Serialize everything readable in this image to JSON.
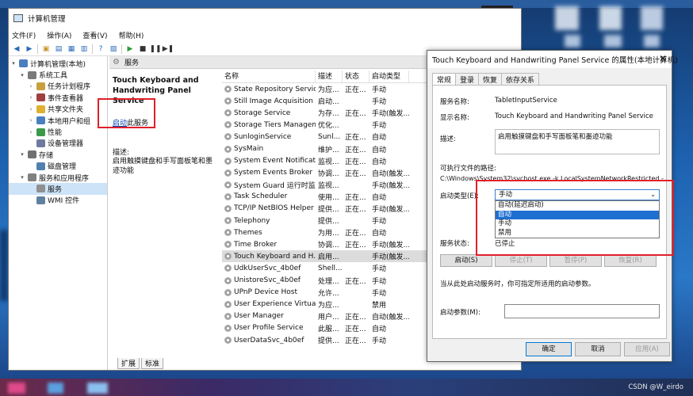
{
  "window": {
    "title": "计算机管理",
    "minimize_glyph": "—"
  },
  "menu": [
    "文件(F)",
    "操作(A)",
    "查看(V)",
    "帮助(H)"
  ],
  "tree": [
    {
      "label": "计算机管理(本地)",
      "level": 0,
      "arrow": "▾",
      "color": "#4a7fc0"
    },
    {
      "label": "系统工具",
      "level": 1,
      "arrow": "▾",
      "color": "#7a7a7a"
    },
    {
      "label": "任务计划程序",
      "level": 2,
      "arrow": "›",
      "color": "#c8a040"
    },
    {
      "label": "事件查看器",
      "level": 2,
      "arrow": "›",
      "color": "#a04040"
    },
    {
      "label": "共享文件夹",
      "level": 2,
      "arrow": "›",
      "color": "#e0b030"
    },
    {
      "label": "本地用户和组",
      "level": 2,
      "arrow": "›",
      "color": "#4a80c0"
    },
    {
      "label": "性能",
      "level": 2,
      "arrow": "›",
      "color": "#3a9a4a"
    },
    {
      "label": "设备管理器",
      "level": 2,
      "arrow": "",
      "color": "#707aa0"
    },
    {
      "label": "存储",
      "level": 1,
      "arrow": "▾",
      "color": "#707070"
    },
    {
      "label": "磁盘管理",
      "level": 2,
      "arrow": "",
      "color": "#5080b0"
    },
    {
      "label": "服务和应用程序",
      "level": 1,
      "arrow": "▾",
      "color": "#808080"
    },
    {
      "label": "服务",
      "level": 2,
      "arrow": "",
      "color": "#909090",
      "selected": true
    },
    {
      "label": "WMI 控件",
      "level": 2,
      "arrow": "",
      "color": "#6080a0"
    }
  ],
  "services_header": "服务",
  "detail": {
    "name_line1": "Touch Keyboard and",
    "name_line2": "Handwriting Panel Service",
    "start_link": "启动",
    "start_suffix": "此服务",
    "desc_label": "描述:",
    "desc_text": "启用触摸键盘和手写面板笔和墨迹功能"
  },
  "columns": [
    "名称",
    "描述",
    "状态",
    "启动类型"
  ],
  "rows": [
    [
      "State Repository Service",
      "为应...",
      "正在...",
      "手动"
    ],
    [
      "Still Image Acquisition E...",
      "启动...",
      "",
      "手动"
    ],
    [
      "Storage Service",
      "为存...",
      "正在...",
      "手动(触发..."
    ],
    [
      "Storage Tiers Managem...",
      "优化...",
      "",
      "手动"
    ],
    [
      "SunloginService",
      "Sunl...",
      "正在...",
      "自动"
    ],
    [
      "SysMain",
      "维护...",
      "正在...",
      "自动"
    ],
    [
      "System Event Notificati...",
      "监视...",
      "正在...",
      "自动"
    ],
    [
      "System Events Broker",
      "协调...",
      "正在...",
      "自动(触发..."
    ],
    [
      "System Guard 运行时监...",
      "监视...",
      "",
      "手动(触发..."
    ],
    [
      "Task Scheduler",
      "使用...",
      "正在...",
      "自动"
    ],
    [
      "TCP/IP NetBIOS Helper",
      "提供...",
      "正在...",
      "手动(触发..."
    ],
    [
      "Telephony",
      "提供...",
      "",
      "手动"
    ],
    [
      "Themes",
      "为用...",
      "正在...",
      "自动"
    ],
    [
      "Time Broker",
      "协调...",
      "正在...",
      "手动(触发..."
    ],
    [
      "Touch Keyboard and H...",
      "启用...",
      "",
      "手动(触发...",
      true
    ],
    [
      "UdkUserSvc_4b0ef",
      "Shell...",
      "",
      "手动"
    ],
    [
      "UnistoreSvc_4b0ef",
      "处理...",
      "正在...",
      "手动"
    ],
    [
      "UPnP Device Host",
      "允许...",
      "",
      "手动"
    ],
    [
      "User Experience Virtuali...",
      "为应...",
      "",
      "禁用"
    ],
    [
      "User Manager",
      "用户...",
      "正在...",
      "自动(触发..."
    ],
    [
      "User Profile Service",
      "此服...",
      "正在...",
      "自动"
    ],
    [
      "UserDataSvc_4b0ef",
      "提供...",
      "正在...",
      "手动"
    ]
  ],
  "bottom_tabs": [
    "扩展",
    "标准"
  ],
  "dialog": {
    "title": "Touch Keyboard and Handwriting Panel Service 的属性(本地计算机)",
    "close": "✕",
    "tabs": [
      "常规",
      "登录",
      "恢复",
      "依存关系"
    ],
    "service_name_label": "服务名称:",
    "service_name": "TabletInputService",
    "display_name_label": "显示名称:",
    "display_name": "Touch Keyboard and Handwriting Panel Service",
    "desc_label": "描述:",
    "desc": "启用触摸键盘和手写面板笔和墨迹功能",
    "path_label": "可执行文件的路径:",
    "path": "C:\\Windows\\System32\\svchost.exe -k LocalSystemNetworkRestricted -p",
    "startup_label": "启动类型(E):",
    "startup_value": "手动",
    "startup_options": [
      "自动(延迟启动)",
      "自动",
      "手动",
      "禁用"
    ],
    "startup_highlight": "自动",
    "status_label": "服务状态:",
    "status_value": "已停止",
    "btn_start": "启动(S)",
    "btn_stop": "停止(T)",
    "btn_pause": "暂停(P)",
    "btn_resume": "恢复(R)",
    "hint": "当从此处启动服务时，你可指定所适用的启动参数。",
    "param_label": "启动参数(M):",
    "ok": "确定",
    "cancel": "取消",
    "apply": "应用(A)"
  },
  "watermark": "CSDN @W_eirdo"
}
